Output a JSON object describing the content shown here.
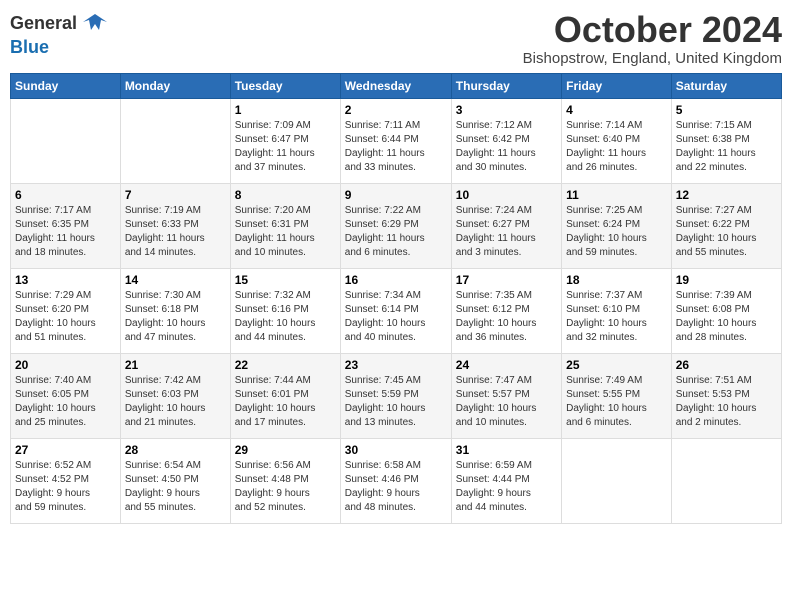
{
  "header": {
    "logo_general": "General",
    "logo_blue": "Blue",
    "month_title": "October 2024",
    "location": "Bishopstrow, England, United Kingdom"
  },
  "days_of_week": [
    "Sunday",
    "Monday",
    "Tuesday",
    "Wednesday",
    "Thursday",
    "Friday",
    "Saturday"
  ],
  "weeks": [
    [
      {
        "day": "",
        "info": ""
      },
      {
        "day": "",
        "info": ""
      },
      {
        "day": "1",
        "info": "Sunrise: 7:09 AM\nSunset: 6:47 PM\nDaylight: 11 hours\nand 37 minutes."
      },
      {
        "day": "2",
        "info": "Sunrise: 7:11 AM\nSunset: 6:44 PM\nDaylight: 11 hours\nand 33 minutes."
      },
      {
        "day": "3",
        "info": "Sunrise: 7:12 AM\nSunset: 6:42 PM\nDaylight: 11 hours\nand 30 minutes."
      },
      {
        "day": "4",
        "info": "Sunrise: 7:14 AM\nSunset: 6:40 PM\nDaylight: 11 hours\nand 26 minutes."
      },
      {
        "day": "5",
        "info": "Sunrise: 7:15 AM\nSunset: 6:38 PM\nDaylight: 11 hours\nand 22 minutes."
      }
    ],
    [
      {
        "day": "6",
        "info": "Sunrise: 7:17 AM\nSunset: 6:35 PM\nDaylight: 11 hours\nand 18 minutes."
      },
      {
        "day": "7",
        "info": "Sunrise: 7:19 AM\nSunset: 6:33 PM\nDaylight: 11 hours\nand 14 minutes."
      },
      {
        "day": "8",
        "info": "Sunrise: 7:20 AM\nSunset: 6:31 PM\nDaylight: 11 hours\nand 10 minutes."
      },
      {
        "day": "9",
        "info": "Sunrise: 7:22 AM\nSunset: 6:29 PM\nDaylight: 11 hours\nand 6 minutes."
      },
      {
        "day": "10",
        "info": "Sunrise: 7:24 AM\nSunset: 6:27 PM\nDaylight: 11 hours\nand 3 minutes."
      },
      {
        "day": "11",
        "info": "Sunrise: 7:25 AM\nSunset: 6:24 PM\nDaylight: 10 hours\nand 59 minutes."
      },
      {
        "day": "12",
        "info": "Sunrise: 7:27 AM\nSunset: 6:22 PM\nDaylight: 10 hours\nand 55 minutes."
      }
    ],
    [
      {
        "day": "13",
        "info": "Sunrise: 7:29 AM\nSunset: 6:20 PM\nDaylight: 10 hours\nand 51 minutes."
      },
      {
        "day": "14",
        "info": "Sunrise: 7:30 AM\nSunset: 6:18 PM\nDaylight: 10 hours\nand 47 minutes."
      },
      {
        "day": "15",
        "info": "Sunrise: 7:32 AM\nSunset: 6:16 PM\nDaylight: 10 hours\nand 44 minutes."
      },
      {
        "day": "16",
        "info": "Sunrise: 7:34 AM\nSunset: 6:14 PM\nDaylight: 10 hours\nand 40 minutes."
      },
      {
        "day": "17",
        "info": "Sunrise: 7:35 AM\nSunset: 6:12 PM\nDaylight: 10 hours\nand 36 minutes."
      },
      {
        "day": "18",
        "info": "Sunrise: 7:37 AM\nSunset: 6:10 PM\nDaylight: 10 hours\nand 32 minutes."
      },
      {
        "day": "19",
        "info": "Sunrise: 7:39 AM\nSunset: 6:08 PM\nDaylight: 10 hours\nand 28 minutes."
      }
    ],
    [
      {
        "day": "20",
        "info": "Sunrise: 7:40 AM\nSunset: 6:05 PM\nDaylight: 10 hours\nand 25 minutes."
      },
      {
        "day": "21",
        "info": "Sunrise: 7:42 AM\nSunset: 6:03 PM\nDaylight: 10 hours\nand 21 minutes."
      },
      {
        "day": "22",
        "info": "Sunrise: 7:44 AM\nSunset: 6:01 PM\nDaylight: 10 hours\nand 17 minutes."
      },
      {
        "day": "23",
        "info": "Sunrise: 7:45 AM\nSunset: 5:59 PM\nDaylight: 10 hours\nand 13 minutes."
      },
      {
        "day": "24",
        "info": "Sunrise: 7:47 AM\nSunset: 5:57 PM\nDaylight: 10 hours\nand 10 minutes."
      },
      {
        "day": "25",
        "info": "Sunrise: 7:49 AM\nSunset: 5:55 PM\nDaylight: 10 hours\nand 6 minutes."
      },
      {
        "day": "26",
        "info": "Sunrise: 7:51 AM\nSunset: 5:53 PM\nDaylight: 10 hours\nand 2 minutes."
      }
    ],
    [
      {
        "day": "27",
        "info": "Sunrise: 6:52 AM\nSunset: 4:52 PM\nDaylight: 9 hours\nand 59 minutes."
      },
      {
        "day": "28",
        "info": "Sunrise: 6:54 AM\nSunset: 4:50 PM\nDaylight: 9 hours\nand 55 minutes."
      },
      {
        "day": "29",
        "info": "Sunrise: 6:56 AM\nSunset: 4:48 PM\nDaylight: 9 hours\nand 52 minutes."
      },
      {
        "day": "30",
        "info": "Sunrise: 6:58 AM\nSunset: 4:46 PM\nDaylight: 9 hours\nand 48 minutes."
      },
      {
        "day": "31",
        "info": "Sunrise: 6:59 AM\nSunset: 4:44 PM\nDaylight: 9 hours\nand 44 minutes."
      },
      {
        "day": "",
        "info": ""
      },
      {
        "day": "",
        "info": ""
      }
    ]
  ]
}
